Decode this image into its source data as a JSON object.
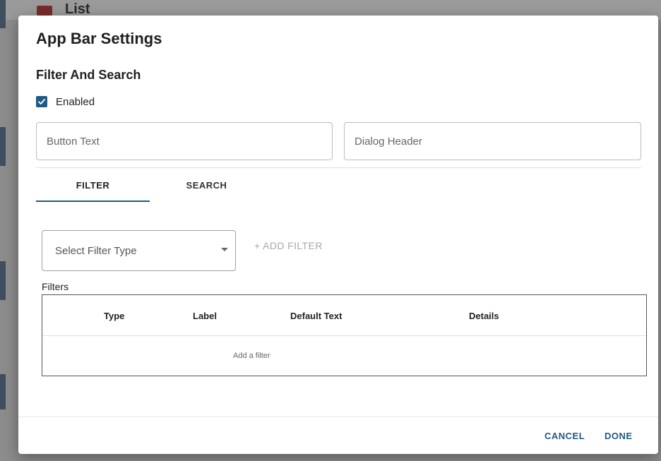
{
  "background": {
    "list_label": "List"
  },
  "dialog": {
    "title": "App Bar Settings",
    "section_title": "Filter And Search",
    "enabled_label": "Enabled",
    "enabled_checked": true,
    "button_text_placeholder": "Button Text",
    "dialog_header_placeholder": "Dialog Header",
    "tabs": [
      {
        "label": "FILTER",
        "active": true
      },
      {
        "label": "SEARCH",
        "active": false
      }
    ],
    "filter_type_select": {
      "placeholder": "Select Filter Type"
    },
    "add_filter_label": "+ ADD FILTER",
    "filters_label": "Filters",
    "table": {
      "columns": [
        "Type",
        "Label",
        "Default Text",
        "Details"
      ],
      "empty_text": "Add a filter"
    },
    "footer": {
      "cancel_label": "CANCEL",
      "done_label": "DONE"
    }
  },
  "colors": {
    "accent": "#1f5a85",
    "backdrop": "#8c8c8c",
    "disabled_text": "#a8a8a8"
  },
  "icons": {
    "checkbox": "check-icon",
    "select": "caret-down-icon",
    "list": "list-icon"
  }
}
